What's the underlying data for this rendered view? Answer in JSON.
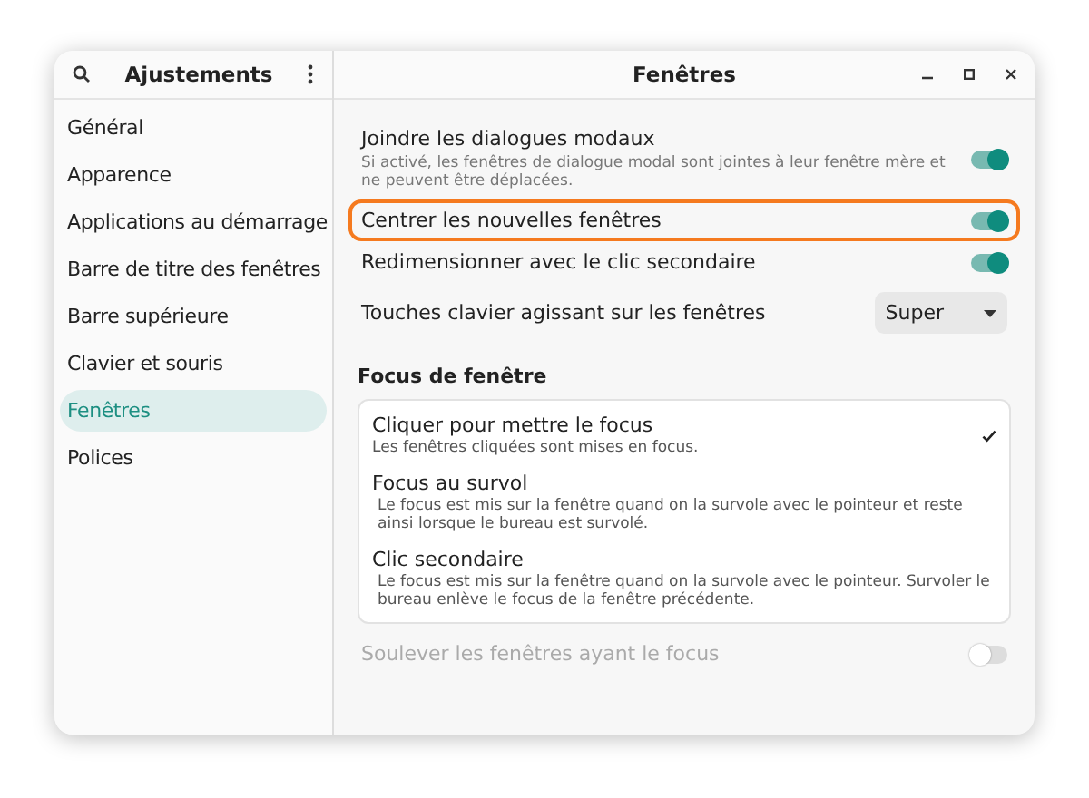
{
  "sidebar": {
    "title": "Ajustements",
    "items": [
      {
        "label": "Général",
        "selected": false
      },
      {
        "label": "Apparence",
        "selected": false
      },
      {
        "label": "Applications au démarrage",
        "selected": false
      },
      {
        "label": "Barre de titre des fenêtres",
        "selected": false
      },
      {
        "label": "Barre supérieure",
        "selected": false
      },
      {
        "label": "Clavier et souris",
        "selected": false
      },
      {
        "label": "Fenêtres",
        "selected": true
      },
      {
        "label": "Polices",
        "selected": false
      }
    ]
  },
  "window": {
    "title": "Fenêtres"
  },
  "settings": [
    {
      "kind": "switch",
      "label": "Joindre les dialogues modaux",
      "description": "Si activé, les fenêtres de dialogue modal sont jointes à leur fenêtre mère et ne peuvent être déplacées.",
      "on": true,
      "highlighted": false
    },
    {
      "kind": "switch",
      "label": "Centrer les nouvelles fenêtres",
      "on": true,
      "highlighted": true
    },
    {
      "kind": "switch",
      "label": "Redimensionner avec le clic secondaire",
      "on": true,
      "highlighted": false
    },
    {
      "kind": "dropdown",
      "label": "Touches clavier agissant sur les fenêtres",
      "value": "Super",
      "highlighted": false
    }
  ],
  "focus": {
    "heading": "Focus de fenêtre",
    "options": [
      {
        "label": "Cliquer pour mettre le focus",
        "description": "Les fenêtres cliquées sont mises en focus.",
        "selected": true
      },
      {
        "label": "Focus au survol",
        "description": "Le focus est mis sur la fenêtre quand on la survole avec le pointeur et reste ainsi lorsque le bureau est survolé.",
        "selected": false
      },
      {
        "label": "Clic secondaire",
        "description": "Le focus est mis sur la fenêtre quand on la survole avec le pointeur. Survoler le bureau enlève le focus de la fenêtre précédente.",
        "selected": false
      }
    ]
  },
  "raise": {
    "label": "Soulever les fenêtres ayant le focus",
    "on": false,
    "disabled": true
  }
}
